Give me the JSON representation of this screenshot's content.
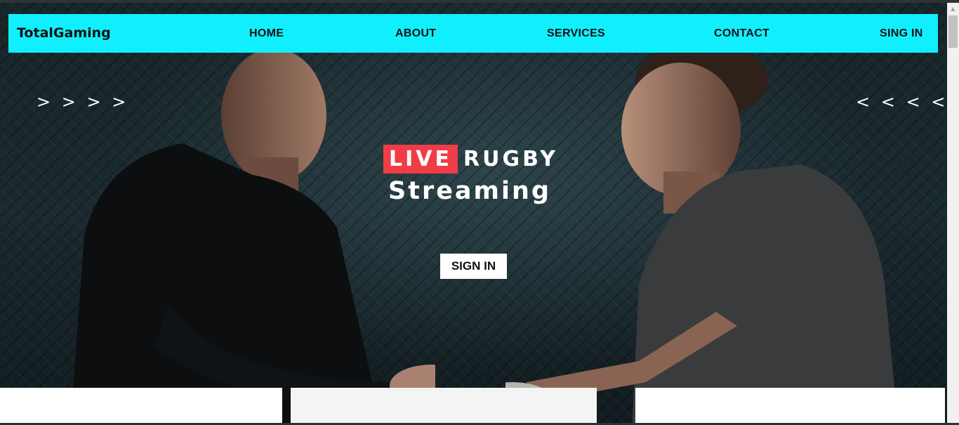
{
  "navbar": {
    "brand": "TotalGaming",
    "links": [
      {
        "label": "HOME"
      },
      {
        "label": "ABOUT"
      },
      {
        "label": "SERVICES"
      },
      {
        "label": "CONTACT"
      },
      {
        "label": "SING IN"
      }
    ],
    "background": "#11efff"
  },
  "hero": {
    "arrows_right": "> > > >",
    "arrows_left": "< < < <",
    "live_badge": "LIVE",
    "sport": "RUGBY",
    "subtitle": "Streaming",
    "cta_label": "SIGN IN",
    "live_color": "#ef3d45"
  }
}
